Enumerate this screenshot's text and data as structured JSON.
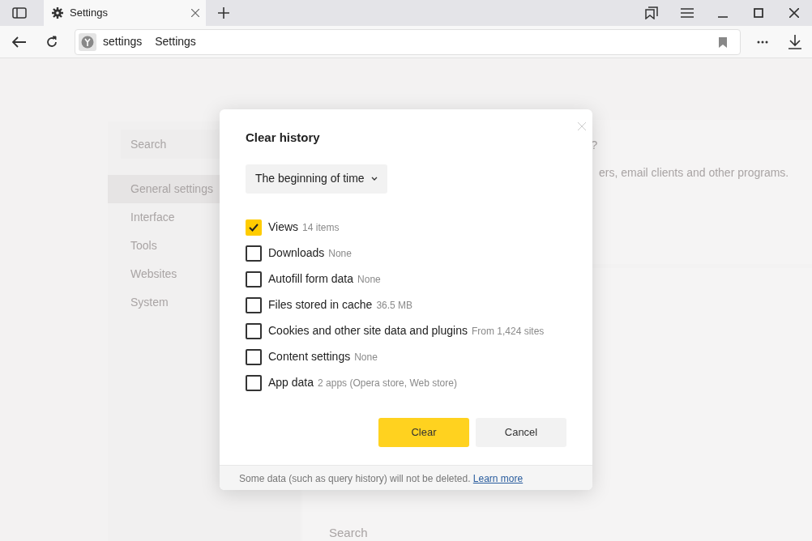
{
  "tabs": [
    {
      "label": "Settings",
      "selected": true
    }
  ],
  "address": {
    "host": "settings",
    "title": "Settings"
  },
  "sidebar": {
    "search_placeholder": "Search",
    "items": [
      {
        "label": "General settings",
        "selected": true
      },
      {
        "label": "Interface",
        "selected": false
      },
      {
        "label": "Tools",
        "selected": false
      },
      {
        "label": "Websites",
        "selected": false
      },
      {
        "label": "System",
        "selected": false
      }
    ]
  },
  "content": {
    "heading_fragment": "?",
    "text_fragment": "ers, email clients and other programs.",
    "search_label": "Search"
  },
  "dialog": {
    "title": "Clear history",
    "period": "The beginning of time",
    "options": [
      {
        "label": "Views",
        "detail": "14 items",
        "checked": true
      },
      {
        "label": "Downloads",
        "detail": "None",
        "checked": false
      },
      {
        "label": "Autofill form data",
        "detail": "None",
        "checked": false
      },
      {
        "label": "Files stored in cache",
        "detail": "36.5 MB",
        "checked": false
      },
      {
        "label": "Cookies and other site data and plugins",
        "detail": "From 1,424 sites",
        "checked": false
      },
      {
        "label": "Content settings",
        "detail": "None",
        "checked": false
      },
      {
        "label": "App data",
        "detail": "2 apps (Opera store, Web store)",
        "checked": false
      }
    ],
    "buttons": [
      {
        "label": "Clear",
        "kind": "primary"
      },
      {
        "label": "Cancel",
        "kind": "secondary"
      }
    ],
    "footer": {
      "text": "Some data (such as query history) will not be deleted.",
      "link": "Learn more"
    }
  }
}
